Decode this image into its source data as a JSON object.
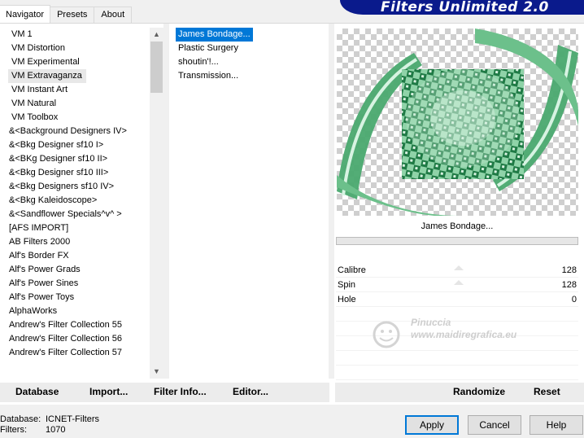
{
  "tabs": [
    "Navigator",
    "Presets",
    "About"
  ],
  "banner_title": "Filters Unlimited 2.0",
  "categories": [
    "VM 1",
    "VM Distortion",
    "VM Experimental",
    "VM Extravaganza",
    "VM Instant Art",
    "VM Natural",
    "VM Toolbox",
    "&<Background Designers IV>",
    "&<Bkg Designer sf10 I>",
    "&<BKg Designer sf10 II>",
    "&<Bkg Designer sf10 III>",
    "&<Bkg Designers sf10 IV>",
    "&<Bkg Kaleidoscope>",
    "&<Sandflower Specials^v^ >",
    "[AFS IMPORT]",
    "AB Filters 2000",
    "Alf's Border FX",
    "Alf's Power Grads",
    "Alf's Power Sines",
    "Alf's Power Toys",
    "AlphaWorks",
    "Andrew's Filter Collection 55",
    "Andrew's Filter Collection 56",
    "Andrew's Filter Collection 57"
  ],
  "selected_category": "VM Extravaganza",
  "filters": [
    "James Bondage...",
    "Plastic Surgery",
    "shoutin'!...",
    "Transmission..."
  ],
  "selected_filter": "James Bondage...",
  "preview_filter_name": "James Bondage...",
  "params": [
    {
      "name": "Calibre",
      "value": "128"
    },
    {
      "name": "Spin",
      "value": "128"
    },
    {
      "name": "Hole",
      "value": "0"
    }
  ],
  "watermark": {
    "line1": "Pinuccia",
    "line2": "www.maidiregrafica.eu"
  },
  "toolbar": {
    "database": "Database",
    "import": "Import...",
    "filter_info": "Filter Info...",
    "editor": "Editor...",
    "randomize": "Randomize",
    "reset": "Reset"
  },
  "status": {
    "database_label": "Database:",
    "database_value": "ICNET-Filters",
    "filters_label": "Filters:",
    "filters_value": "1070"
  },
  "buttons": {
    "apply": "Apply",
    "cancel": "Cancel",
    "help": "Help"
  },
  "colors": {
    "banner": "#0a1a8c",
    "selection": "#0078d7",
    "preview_green": "#2f9e62"
  }
}
